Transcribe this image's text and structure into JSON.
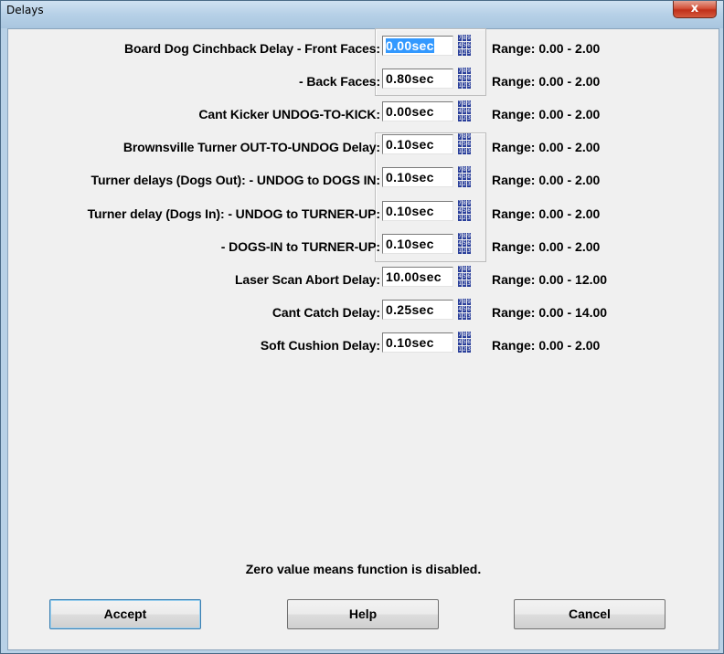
{
  "window": {
    "title": "Delays",
    "close_label": "x"
  },
  "keypad_icon": {
    "name": "numeric-keypad-icon",
    "digits": [
      "7",
      "8",
      "9",
      "4",
      "5",
      "6",
      "1",
      "2",
      "3"
    ]
  },
  "rows": [
    {
      "label": "Board Dog Cinchback Delay - Front Faces:",
      "value": "0.00sec",
      "range": "Range: 0.00 - 2.00",
      "selected": true
    },
    {
      "label": "- Back Faces:",
      "value": "0.80sec",
      "range": "Range: 0.00 - 2.00"
    },
    {
      "label": "Cant Kicker UNDOG-TO-KICK:",
      "value": "0.00sec",
      "range": "Range: 0.00 - 2.00"
    },
    {
      "label": "Brownsville Turner OUT-TO-UNDOG Delay:",
      "value": "0.10sec",
      "range": "Range: 0.00 - 2.00"
    },
    {
      "label": "Turner delays (Dogs Out): - UNDOG to DOGS IN:",
      "value": "0.10sec",
      "range": "Range: 0.00 - 2.00"
    },
    {
      "label": "Turner delay (Dogs In): - UNDOG to TURNER-UP:",
      "value": "0.10sec",
      "range": "Range: 0.00 - 2.00"
    },
    {
      "label": "- DOGS-IN to TURNER-UP:",
      "value": "0.10sec",
      "range": "Range: 0.00 - 2.00"
    },
    {
      "label": "Laser Scan Abort Delay:",
      "value": "10.00sec",
      "range": "Range: 0.00 - 12.00"
    },
    {
      "label": "Cant Catch Delay:",
      "value": "0.25sec",
      "range": "Range: 0.00 - 14.00"
    },
    {
      "label": "Soft Cushion Delay:",
      "value": "0.10sec",
      "range": "Range: 0.00 - 2.00"
    }
  ],
  "note": "Zero value means function is disabled.",
  "buttons": {
    "accept": "Accept",
    "help": "Help",
    "cancel": "Cancel"
  }
}
